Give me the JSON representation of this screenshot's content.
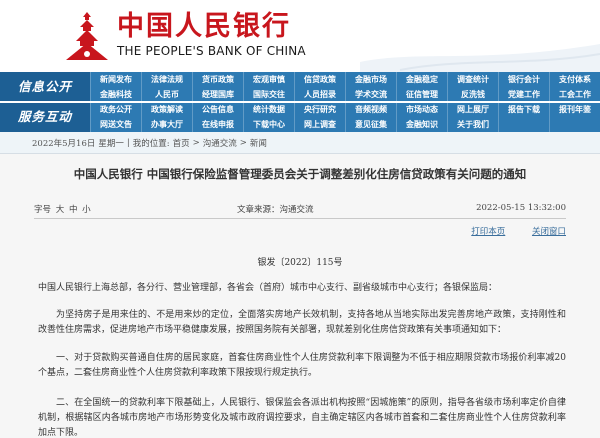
{
  "header": {
    "title_cn": "中国人民银行",
    "title_en": "THE PEOPLE'S BANK OF CHINA"
  },
  "nav": {
    "section1": "信息公开",
    "section2": "服务互动",
    "rows": [
      [
        "新闻发布",
        "法律法规",
        "货币政策",
        "宏观审慎",
        "信贷政策",
        "金融市场",
        "金融稳定",
        "调查统计",
        "银行会计",
        "支付体系"
      ],
      [
        "金融科技",
        "人民币",
        "经理国库",
        "国际交往",
        "人员招录",
        "学术交流",
        "征信管理",
        "反洗钱",
        "党建工作",
        "工会工作"
      ],
      [
        "政务公开",
        "政策解读",
        "公告信息",
        "统计数据",
        "央行研究",
        "音频视频",
        "市场动态",
        "网上展厅",
        "报告下载",
        "报刊年鉴"
      ],
      [
        "网送文告",
        "办事大厅",
        "在线申报",
        "下载中心",
        "网上调查",
        "意见征集",
        "金融知识",
        "关于我们",
        "",
        ""
      ]
    ]
  },
  "breadcrumb": {
    "date": "2022年5月16日",
    "weekday": "星期一",
    "sep": "|",
    "prefix": "我的位置:",
    "items": [
      "首页",
      "沟通交流",
      "新闻"
    ],
    "arrow": ">"
  },
  "article": {
    "title": "中国人民银行 中国银行保险监督管理委员会关于调整差别化住房信贷政策有关问题的通知",
    "font_size_label": "字号",
    "font_sizes": [
      "大",
      "中",
      "小"
    ],
    "source_label": "文章来源：",
    "source": "沟通交流",
    "date": "2022-05-15 13:32:00",
    "print_label": "打印本页",
    "close_label": "关闭窗口",
    "doc_number": "银发〔2022〕115号",
    "addressees": "中国人民银行上海总部，各分行、营业管理部，各省会（首府）城市中心支行、副省级城市中心支行；各银保监局：",
    "para1": "为坚持房子是用来住的、不是用来炒的定位，全面落实房地产长效机制，支持各地从当地实际出发完善房地产政策，支持刚性和改善性住房需求，促进房地产市场平稳健康发展，按照国务院有关部署，现就差别化住房信贷政策有关事项通知如下：",
    "para2": "一、对于贷款购买普通自住房的居民家庭，首套住房商业性个人住房贷款利率下限调整为不低于相应期限贷款市场报价利率减20个基点，二套住房商业性个人住房贷款利率政策下限按现行规定执行。",
    "para3": "二、在全国统一的贷款利率下限基础上，人民银行、银保监会各派出机构按照“因城施策”的原则，指导各省级市场利率定价自律机制，根据辖区内各城市房地产市场形势变化及城市政府调控要求，自主确定辖区内各城市首套和二套住房商业性个人住房贷款利率加点下限。"
  },
  "colors": {
    "brand_red": "#c8161d",
    "nav_blue": "#2d7ab3",
    "nav_section_blue": "#1d5f94",
    "link_blue": "#3a6e9c"
  }
}
